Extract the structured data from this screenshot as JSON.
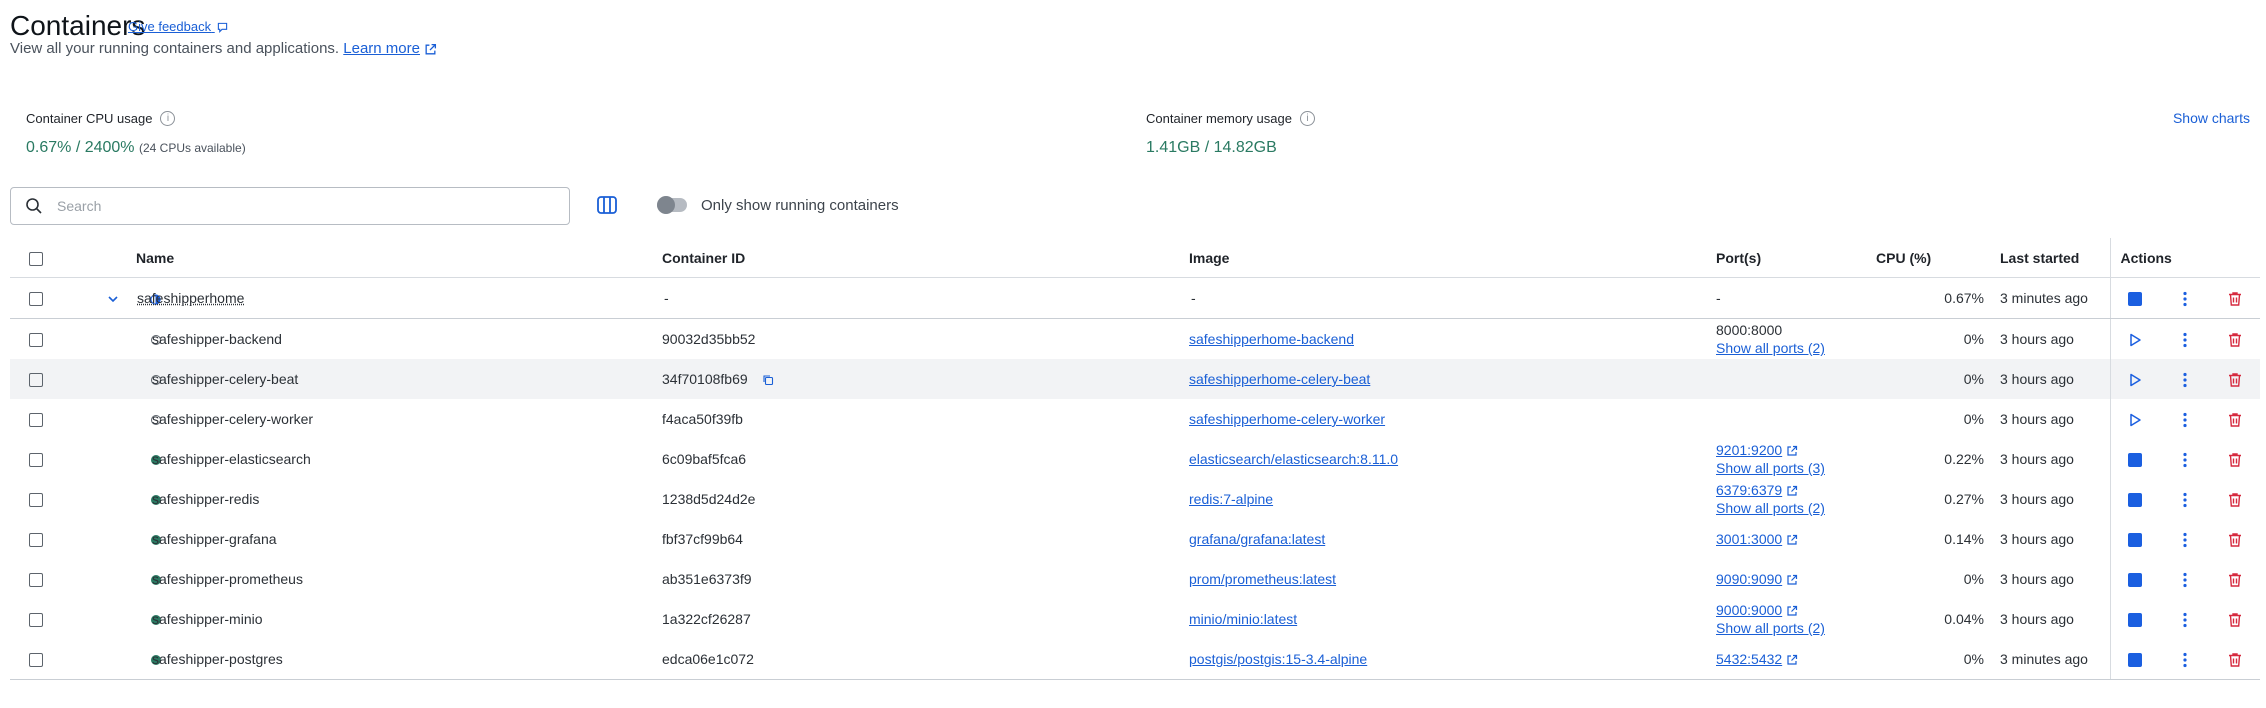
{
  "header": {
    "title": "Containers",
    "feedback_label": "Give feedback",
    "subtitle": "View all your running containers and applications.",
    "learn_more": "Learn more"
  },
  "stats": {
    "cpu_label": "Container CPU usage",
    "cpu_value": "0.67% / 2400%",
    "cpu_note": "(24 CPUs available)",
    "mem_label": "Container memory usage",
    "mem_value": "1.41GB / 14.82GB",
    "show_charts": "Show charts"
  },
  "toolbar": {
    "search_placeholder": "Search",
    "running_toggle_label": "Only show running containers"
  },
  "columns": {
    "name": "Name",
    "container_id": "Container ID",
    "image": "Image",
    "ports": "Port(s)",
    "cpu": "CPU (%)",
    "last_started": "Last started",
    "actions": "Actions"
  },
  "group": {
    "name": "safeshipperhome",
    "container_id": "-",
    "image": "-",
    "ports": "-",
    "cpu": "0.67%",
    "last_started": "3 minutes ago"
  },
  "rows": [
    {
      "name": "safeshipper-backend",
      "id": "90032d35bb52",
      "image": "safeshipperhome-backend",
      "port": "8000:8000",
      "port_linked": false,
      "more_ports": "Show all ports (2)",
      "cpu": "0%",
      "last": "3 hours ago"
    },
    {
      "name": "safeshipper-celery-beat",
      "id": "34f70108fb69",
      "image": "safeshipperhome-celery-beat",
      "port": "",
      "port_linked": false,
      "more_ports": "",
      "cpu": "0%",
      "last": "3 hours ago"
    },
    {
      "name": "safeshipper-celery-worker",
      "id": "f4aca50f39fb",
      "image": "safeshipperhome-celery-worker",
      "port": "",
      "port_linked": false,
      "more_ports": "",
      "cpu": "0%",
      "last": "3 hours ago"
    },
    {
      "name": "safeshipper-elasticsearch",
      "id": "6c09baf5fca6",
      "image": "elasticsearch/elasticsearch:8.11.0",
      "port": "9201:9200",
      "port_linked": true,
      "more_ports": "Show all ports (3)",
      "cpu": "0.22%",
      "last": "3 hours ago"
    },
    {
      "name": "safeshipper-redis",
      "id": "1238d5d24d2e",
      "image": "redis:7-alpine",
      "port": "6379:6379",
      "port_linked": true,
      "more_ports": "Show all ports (2)",
      "cpu": "0.27%",
      "last": "3 hours ago"
    },
    {
      "name": "safeshipper-grafana",
      "id": "fbf37cf99b64",
      "image": "grafana/grafana:latest",
      "port": "3001:3000",
      "port_linked": true,
      "more_ports": "",
      "cpu": "0.14%",
      "last": "3 hours ago"
    },
    {
      "name": "safeshipper-prometheus",
      "id": "ab351e6373f9",
      "image": "prom/prometheus:latest",
      "port": "9090:9090",
      "port_linked": true,
      "more_ports": "",
      "cpu": "0%",
      "last": "3 hours ago"
    },
    {
      "name": "safeshipper-minio",
      "id": "1a322cf26287",
      "image": "minio/minio:latest",
      "port": "9000:9000",
      "port_linked": true,
      "more_ports": "Show all ports (2)",
      "cpu": "0.04%",
      "last": "3 hours ago"
    },
    {
      "name": "safeshipper-postgres",
      "id": "edca06e1c072",
      "image": "postgis/postgis:15-3.4-alpine",
      "port": "5432:5432",
      "port_linked": true,
      "more_ports": "",
      "cpu": "0%",
      "last": "3 minutes ago"
    }
  ],
  "row_state": [
    "stopped",
    "stopped",
    "stopped",
    "running",
    "running",
    "running",
    "running",
    "running",
    "running"
  ],
  "colors": {
    "accent": "#1a5fd6",
    "running": "#2a7a62",
    "delete": "#d6293e",
    "stop": "#1b5fe0"
  },
  "icons": [
    "search-icon",
    "columns-icon",
    "info-icon",
    "chevron-down-icon",
    "half-circle-icon",
    "copy-icon",
    "external-link-icon",
    "stop-icon",
    "play-icon",
    "kebab-menu-icon",
    "trash-icon",
    "feedback-icon"
  ]
}
